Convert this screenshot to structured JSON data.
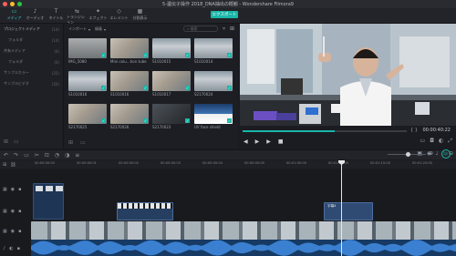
{
  "window": {
    "title": "5-遺伝子操作 2018_DNA抽出の概観 - Wondershare Filmora9",
    "traffic": [
      "#ff5f57",
      "#febc2e",
      "#28c840"
    ]
  },
  "toolbar": {
    "tabs": [
      {
        "icon": "media-icon",
        "label": "メディア",
        "active": true
      },
      {
        "icon": "audio-icon",
        "label": "オーディオ",
        "active": false
      },
      {
        "icon": "title-icon",
        "label": "タイトル",
        "active": false
      },
      {
        "icon": "transition-icon",
        "label": "トランジション",
        "active": false
      },
      {
        "icon": "effects-icon",
        "label": "エフェクト",
        "active": false
      },
      {
        "icon": "elements-icon",
        "label": "エレメント",
        "active": false
      },
      {
        "icon": "split-screen-icon",
        "label": "分割表示",
        "active": false
      }
    ],
    "export_label": "エクスポート",
    "accent": "#19b6a7"
  },
  "sidebar": {
    "items": [
      {
        "label": "プロジェクトメディア",
        "count": "(14)",
        "sub": false,
        "active": true
      },
      {
        "label": "フォルダ",
        "count": "(14)",
        "sub": true,
        "active": false
      },
      {
        "label": "共有メディア",
        "count": "(0)",
        "sub": false,
        "active": false
      },
      {
        "label": "フォルダ",
        "count": "(0)",
        "sub": true,
        "active": false
      },
      {
        "label": "サンプルカラー",
        "count": "(25)",
        "sub": false,
        "active": false
      },
      {
        "label": "サンプルビデオ",
        "count": "(20)",
        "sub": false,
        "active": false
      }
    ]
  },
  "media": {
    "import_label": "インポート",
    "record_label": "録画",
    "search_placeholder": "検索",
    "items": [
      {
        "name": "IMG_5080",
        "style": "thumb-gray"
      },
      {
        "name": "Mini colu...tion tube",
        "style": "thumb-hand"
      },
      {
        "name": "S1010015",
        "style": "thumb-lab"
      },
      {
        "name": "S1010014",
        "style": "thumb-lab"
      },
      {
        "name": "S1010016",
        "style": "thumb-lab"
      },
      {
        "name": "S1010016",
        "style": "thumb-hand"
      },
      {
        "name": "S1010017",
        "style": "thumb-hand"
      },
      {
        "name": "S2170024",
        "style": "thumb-lab"
      },
      {
        "name": "S2170025",
        "style": "thumb-hand"
      },
      {
        "name": "S2170026",
        "style": "thumb-hand"
      },
      {
        "name": "S2170023",
        "style": "thumb-dark"
      },
      {
        "name": "UV face shield",
        "style": "thumb-screen"
      }
    ]
  },
  "preview": {
    "progress": 0.56,
    "timecode": "00:00:40:22"
  },
  "timeline": {
    "ruler": [
      "00:00:00:00",
      "00:00:00:01",
      "00:00:00:02",
      "00:00:00:03",
      "00:00:00:04",
      "00:00:00:05",
      "00:01:00:00",
      "00:01:10:00",
      "00:01:15:00",
      "00:01:20:00"
    ],
    "title_clip_label": "字幕4",
    "track_colors": {
      "video": "#2e4a70",
      "audio": "#163a63"
    }
  }
}
